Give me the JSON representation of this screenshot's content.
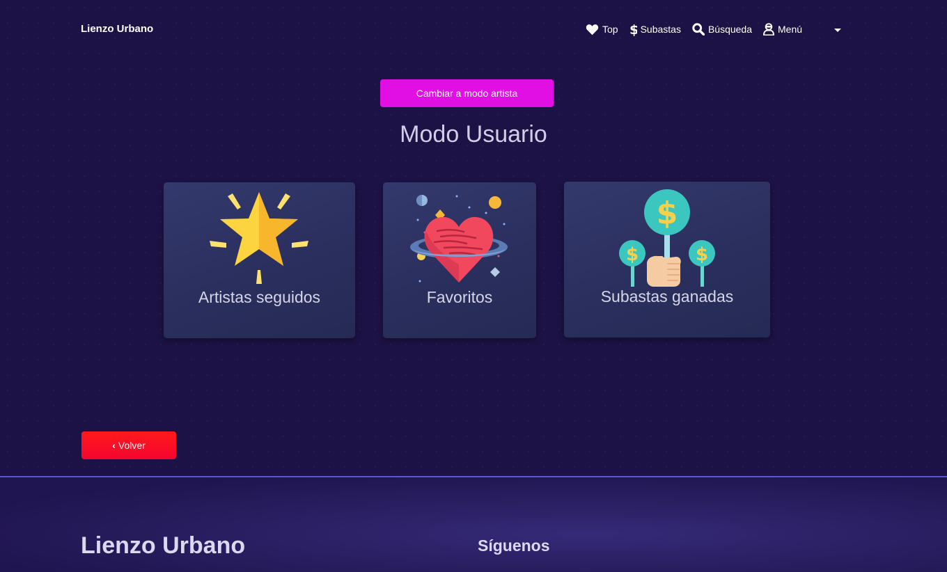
{
  "navbar": {
    "brand": "Lienzo Urbano",
    "items": [
      {
        "label": "Top",
        "icon": "heart-icon"
      },
      {
        "label": "Subastas",
        "icon": "dollar-icon"
      },
      {
        "label": "Búsqueda",
        "icon": "search-icon"
      },
      {
        "label": "Menú",
        "icon": "user-icon"
      }
    ]
  },
  "main": {
    "mode_button": "Cambiar a modo artista",
    "title": "Modo Usuario",
    "cards": [
      {
        "label": "Artistas seguidos",
        "icon": "star-icon"
      },
      {
        "label": "Favoritos",
        "icon": "heart-planet-icon"
      },
      {
        "label": "Subastas ganadas",
        "icon": "money-auction-icon"
      }
    ],
    "back_button": "Volver"
  },
  "footer": {
    "brand": "Lienzo Urbano",
    "follow_heading": "Síguenos"
  },
  "colors": {
    "background": "#1d1245",
    "mode_button": "#e10fe3",
    "back_button": "#f90d22",
    "footer_border": "#4f5bd0"
  }
}
